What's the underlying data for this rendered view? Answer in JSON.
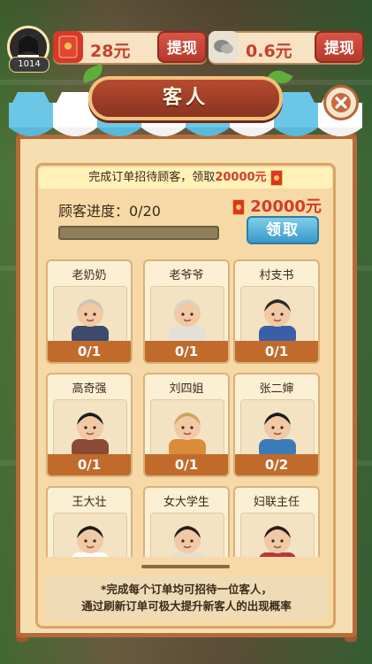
{
  "hud": {
    "level": "1014",
    "cash_value": "28元",
    "cash_withdraw": "提现",
    "wechat_value": "0.6元",
    "wechat_withdraw": "提现"
  },
  "dialog": {
    "title": "客人",
    "task": {
      "prefix": "完成订单招待顾客，领取",
      "amount": "20000元",
      "progress_label": "顾客进度：0/20",
      "progress_fraction": 0,
      "reward": "20000元",
      "claim_label": "领取"
    },
    "guests": [
      {
        "name": "老奶奶",
        "count": "0/1"
      },
      {
        "name": "老爷爷",
        "count": "0/1"
      },
      {
        "name": "村支书",
        "count": "0/1"
      },
      {
        "name": "高奇强",
        "count": "0/1"
      },
      {
        "name": "刘四姐",
        "count": "0/1"
      },
      {
        "name": "张二婶",
        "count": "0/2"
      },
      {
        "name": "王大壮",
        "count": ""
      },
      {
        "name": "女大学生",
        "count": ""
      },
      {
        "name": "妇联主任",
        "count": ""
      }
    ],
    "hint_line1": "*完成每个订单均可招待一位客人，",
    "hint_line2": "通过刷新订单可极大提升新客人的出现概率"
  },
  "colors": {
    "accent_red": "#d43b2b",
    "claim_blue": "#3a98c9",
    "count_bar": "#c06b2c"
  }
}
